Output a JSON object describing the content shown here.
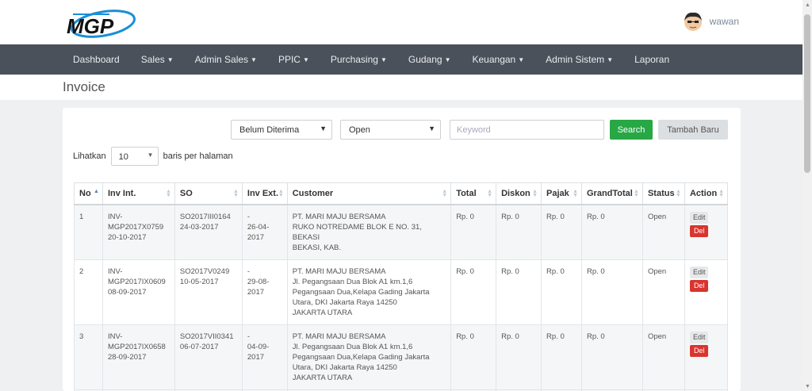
{
  "user": {
    "name": "wawan"
  },
  "nav": [
    {
      "label": "Dashboard",
      "dropdown": false
    },
    {
      "label": "Sales",
      "dropdown": true
    },
    {
      "label": "Admin Sales",
      "dropdown": true
    },
    {
      "label": "PPIC",
      "dropdown": true
    },
    {
      "label": "Purchasing",
      "dropdown": true
    },
    {
      "label": "Gudang",
      "dropdown": true
    },
    {
      "label": "Keuangan",
      "dropdown": true
    },
    {
      "label": "Admin Sistem",
      "dropdown": true
    },
    {
      "label": "Laporan",
      "dropdown": false
    }
  ],
  "page": {
    "title": "Invoice"
  },
  "filters": {
    "status_select": "Belum Diterima",
    "open_select": "Open",
    "keyword_placeholder": "Keyword",
    "search_label": "Search",
    "new_label": "Tambah Baru"
  },
  "length": {
    "prefix": "Lihatkan",
    "value": "10",
    "suffix": "baris per halaman"
  },
  "table": {
    "headers": [
      "No",
      "Inv Int.",
      "SO",
      "Inv Ext.",
      "Customer",
      "Total",
      "Diskon",
      "Pajak",
      "GrandTotal",
      "Status",
      "Action"
    ],
    "rows": [
      {
        "no": "1",
        "inv_int": "INV-MGP2017X0759",
        "inv_int_date": "20-10-2017",
        "so": "SO2017III0164",
        "so_date": "24-03-2017",
        "inv_ext": "-",
        "inv_ext_date": "26-04-2017",
        "customer_name": "PT. MARI MAJU BERSAMA",
        "customer_addr": "RUKO NOTREDAME BLOK E NO. 31, BEKASI",
        "customer_city": "BEKASI, KAB.",
        "total": "Rp. 0",
        "diskon": "Rp. 0",
        "pajak": "Rp. 0",
        "grandtotal": "Rp. 0",
        "status": "Open"
      },
      {
        "no": "2",
        "inv_int": "INV-MGP2017IX0609",
        "inv_int_date": "08-09-2017",
        "so": "SO2017V0249",
        "so_date": "10-05-2017",
        "inv_ext": "-",
        "inv_ext_date": "29-08-2017",
        "customer_name": "PT. MARI MAJU BERSAMA",
        "customer_addr": "Jl. Pegangsaan Dua Blok A1 km.1,6 Pegangsaan Dua,Kelapa Gading Jakarta Utara, DKI Jakarta Raya 14250",
        "customer_city": "JAKARTA UTARA",
        "total": "Rp. 0",
        "diskon": "Rp. 0",
        "pajak": "Rp. 0",
        "grandtotal": "Rp. 0",
        "status": "Open"
      },
      {
        "no": "3",
        "inv_int": "INV-MGP2017IX0658",
        "inv_int_date": "28-09-2017",
        "so": "SO2017VII0341",
        "so_date": "06-07-2017",
        "inv_ext": "-",
        "inv_ext_date": "04-09-2017",
        "customer_name": "PT. MARI MAJU BERSAMA",
        "customer_addr": "Jl. Pegangsaan Dua Blok A1 km.1,6 Pegangsaan Dua,Kelapa Gading Jakarta Utara, DKI Jakarta Raya 14250",
        "customer_city": "JAKARTA UTARA",
        "total": "Rp. 0",
        "diskon": "Rp. 0",
        "pajak": "Rp. 0",
        "grandtotal": "Rp. 0",
        "status": "Open"
      }
    ],
    "edit_label": "Edit",
    "del_label": "Del"
  },
  "colors": {
    "nav_bg": "#4a515b",
    "search": "#28a745",
    "del": "#d9352e"
  }
}
